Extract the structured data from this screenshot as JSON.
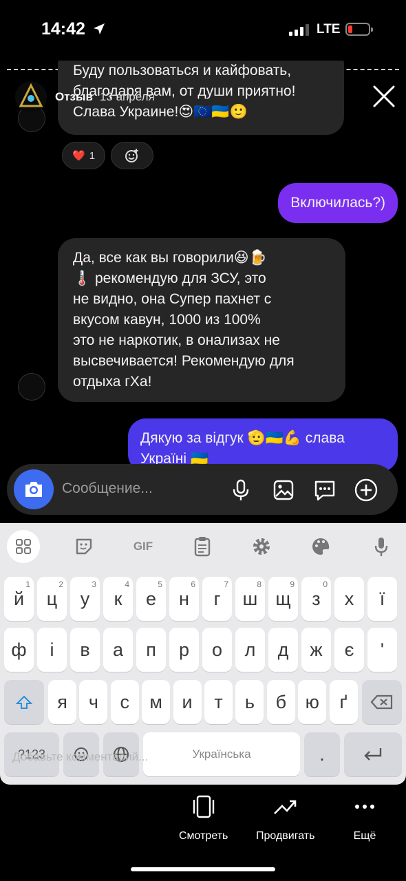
{
  "status": {
    "time": "14:42",
    "network": "LTE",
    "battery_color": "#ff3b30"
  },
  "story": {
    "username": "Отзыв",
    "date": "13 апреля",
    "avatar_badge": "SPRAYS"
  },
  "chat": {
    "msg_top_lines": [
      "Буду пользоваться и кайфовать,",
      "благодаря вам, от души приятно!",
      "Слава Украине!😍🇪🇺🇺🇦🙂"
    ],
    "reaction_heart": "❤️",
    "reaction_count": "1",
    "msg_out1": "Включилась?)",
    "msg_mid_lines": [
      "Да, все как вы говорили😆🍺",
      "🌡️ рекомендую для ЗСУ, это",
      "не видно, она Супер пахнет с",
      "вкусом кавун, 1000 из 100%",
      "это не наркотик, в онализах не",
      "высвечивается! Рекомендую для",
      "отдыха гХа!"
    ],
    "msg_out2_lines": [
      "Дякую за відгук 🫡🇺🇦💪 слава",
      "Україні 🇺🇦"
    ]
  },
  "composer": {
    "placeholder": "Сообщение..."
  },
  "keyboard": {
    "toolbar": [
      "grid-icon",
      "sticker-icon",
      "GIF",
      "clipboard-icon",
      "gear-icon",
      "palette-icon",
      "mic-icon"
    ],
    "row1": [
      {
        "k": "й",
        "n": "1"
      },
      {
        "k": "ц",
        "n": "2"
      },
      {
        "k": "у",
        "n": "3"
      },
      {
        "k": "к",
        "n": "4"
      },
      {
        "k": "е",
        "n": "5"
      },
      {
        "k": "н",
        "n": "6"
      },
      {
        "k": "г",
        "n": "7"
      },
      {
        "k": "ш",
        "n": "8"
      },
      {
        "k": "щ",
        "n": "9"
      },
      {
        "k": "з",
        "n": "0"
      },
      {
        "k": "х",
        "n": ""
      },
      {
        "k": "ї",
        "n": ""
      }
    ],
    "row2": [
      "ф",
      "і",
      "в",
      "а",
      "п",
      "р",
      "о",
      "л",
      "д",
      "ж",
      "є",
      "'"
    ],
    "row3": [
      "я",
      "ч",
      "с",
      "м",
      "и",
      "т",
      "ь",
      "б",
      "ю",
      "ґ"
    ],
    "num_key": "?123",
    "space_label": "Українська",
    "period": ".",
    "comment_placeholder": "Добавьте комментарий..."
  },
  "bottom": {
    "watch": "Смотреть",
    "promote": "Продвигать",
    "more": "Ещё"
  }
}
